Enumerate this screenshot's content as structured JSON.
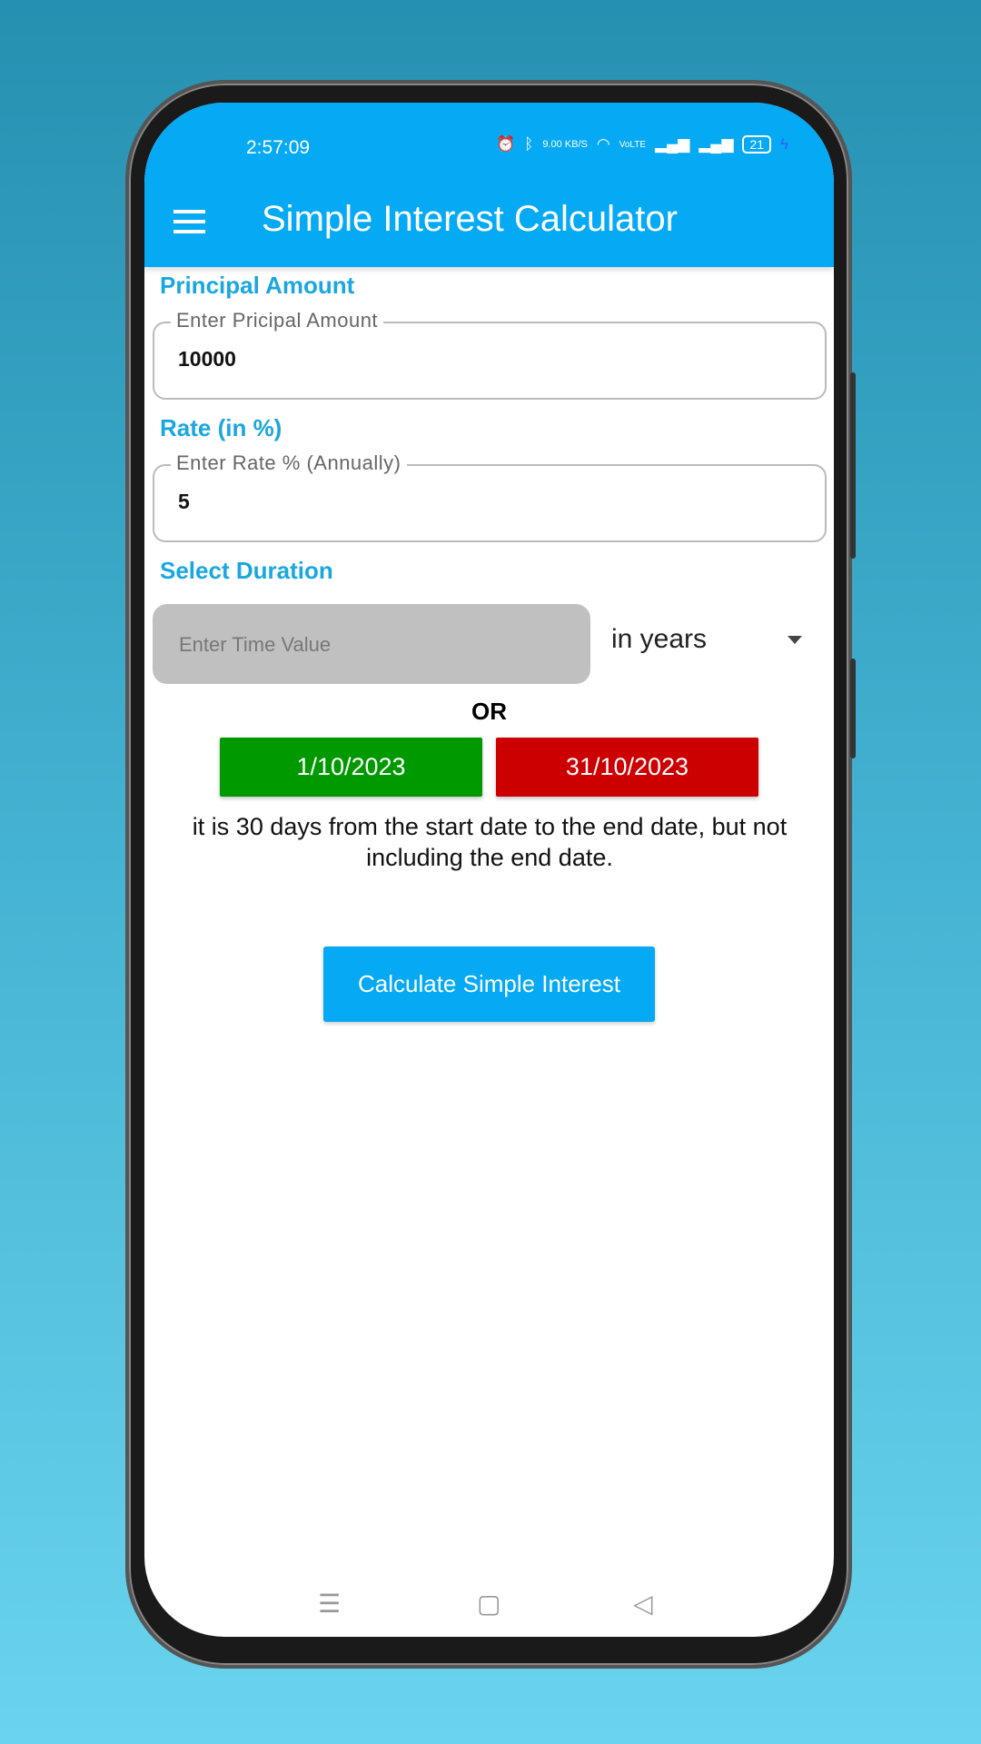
{
  "status_bar": {
    "time": "2:57:09",
    "net_speed": "9.00 KB/S",
    "network": "VoLTE",
    "battery": "21"
  },
  "header": {
    "title": "Simple Interest Calculator",
    "menu_icon": "hamburger-icon"
  },
  "principal": {
    "label": "Principal Amount",
    "field_label": "Enter Pricipal Amount",
    "value": "10000"
  },
  "rate": {
    "label": "Rate (in %)",
    "field_label": "Enter Rate % (Annually)",
    "value": "5"
  },
  "duration": {
    "label": "Select Duration",
    "placeholder": "Enter Time Value",
    "unit": "in years",
    "or": "OR",
    "start_date": "1/10/2023",
    "end_date": "31/10/2023",
    "start_color": "#009900",
    "end_color": "#cc0000",
    "info": "it is 30  days from the start date to the end date, but not including the end date."
  },
  "calculate_label": "Calculate Simple Interest",
  "nav": {
    "menu": "☰",
    "home": "▢",
    "back": "◁"
  }
}
